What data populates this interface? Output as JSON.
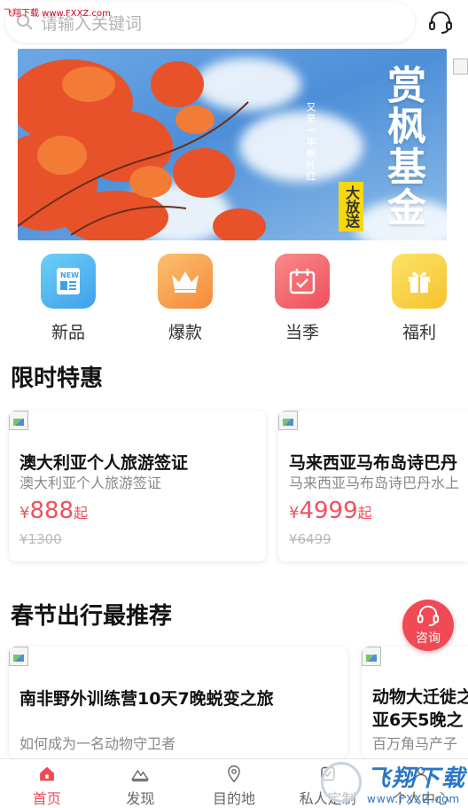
{
  "watermark": "飞翔下载 www.FXXZ.com",
  "search": {
    "placeholder": "请输入关键词"
  },
  "banner": {
    "title": "赏枫基金",
    "subtitle": "又是一年枫叶红",
    "tag": "大放送"
  },
  "quick_nav": [
    {
      "label": "新品",
      "icon": "new-icon",
      "color": "#4fb6ef"
    },
    {
      "label": "爆款",
      "icon": "crown-icon",
      "color": "#f7a84a"
    },
    {
      "label": "当季",
      "icon": "calendar-icon",
      "color": "#f2626a"
    },
    {
      "label": "福利",
      "icon": "gift-icon",
      "color": "#f9cf3e"
    }
  ],
  "sections": {
    "limited": {
      "title": "限时特惠",
      "cards": [
        {
          "title": "澳大利亚个人旅游签证",
          "subtitle": "澳大利亚个人旅游签证",
          "currency": "¥",
          "price": "888",
          "unit": "起",
          "old_price": "¥1300"
        },
        {
          "title": "马来西亚马布岛诗巴丹",
          "subtitle": "马来西亚马布岛诗巴丹水上",
          "currency": "¥",
          "price": "4999",
          "unit": "起",
          "old_price": "¥6499"
        }
      ]
    },
    "festival": {
      "title": "春节出行最推荐",
      "cards": [
        {
          "title": "南非野外训练营10天7晚蜕变之旅",
          "subtitle": "如何成为一名动物守卫者"
        },
        {
          "title": "动物大迁徙之",
          "title2": "亚6天5晚之",
          "subtitle": "百万角马产子"
        }
      ]
    }
  },
  "consult": {
    "label": "咨询"
  },
  "tabs": [
    {
      "label": "首页",
      "icon": "home-icon",
      "active": true
    },
    {
      "label": "发现",
      "icon": "mountain-icon",
      "active": false
    },
    {
      "label": "目的地",
      "icon": "location-icon",
      "active": false
    },
    {
      "label": "私人定制",
      "icon": "custom-icon",
      "active": false
    },
    {
      "label": "个人中心",
      "icon": "user-icon",
      "active": false
    }
  ],
  "watermark_logo": {
    "text1": "飞翔下载",
    "text2": "www.FXXZ.com"
  },
  "colors": {
    "accent": "#ef4a55",
    "price": "#f0505f"
  }
}
